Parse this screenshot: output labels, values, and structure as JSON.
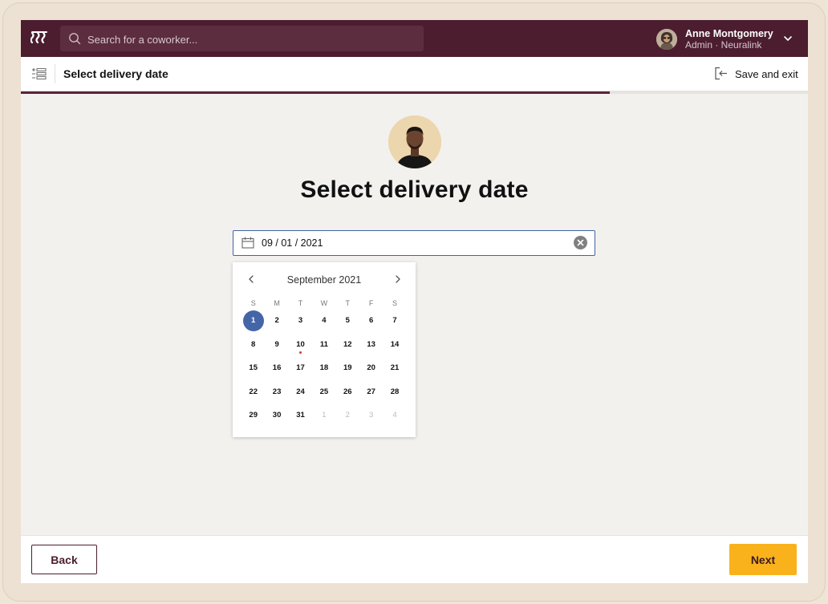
{
  "topbar": {
    "search_placeholder": "Search for a coworker...",
    "user_name": "Anne Montgomery",
    "user_role": "Admin · Neuralink"
  },
  "subheader": {
    "title": "Select delivery date",
    "save_exit": "Save and exit",
    "progress_fraction": 0.748
  },
  "main": {
    "heading": "Select delivery date",
    "date_value": "09 / 01 / 2021"
  },
  "calendar": {
    "month": "September 2021",
    "weekdays": [
      "S",
      "M",
      "T",
      "W",
      "T",
      "F",
      "S"
    ],
    "selected_day": "1",
    "marked_day": "10",
    "weeks": [
      [
        "1",
        "2",
        "3",
        "4",
        "5",
        "6",
        "7"
      ],
      [
        "8",
        "9",
        "10",
        "11",
        "12",
        "13",
        "14"
      ],
      [
        "15",
        "16",
        "17",
        "18",
        "19",
        "20",
        "21"
      ],
      [
        "22",
        "23",
        "24",
        "25",
        "26",
        "27",
        "28"
      ],
      [
        "29",
        "30",
        "31",
        "1",
        "2",
        "3",
        "4"
      ]
    ],
    "trailing_other_month_count": 4
  },
  "footer": {
    "back_label": "Back",
    "next_label": "Next"
  },
  "colors": {
    "brand": "#4b1d2f",
    "accent": "#f9b21c",
    "selected": "#4466a8",
    "marker": "#d23b2b"
  }
}
